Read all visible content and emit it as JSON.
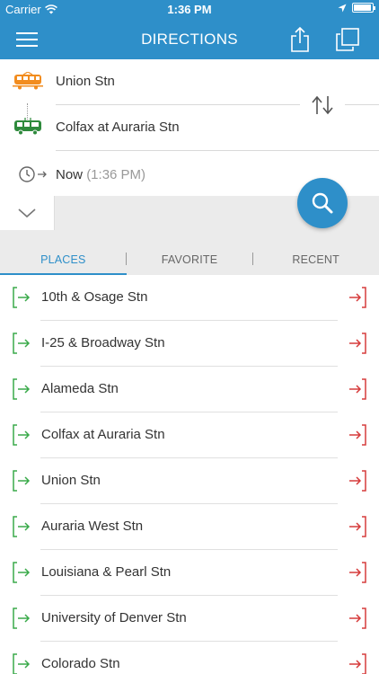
{
  "status_bar": {
    "carrier": "Carrier",
    "time": "1:36 PM"
  },
  "nav": {
    "title": "DIRECTIONS"
  },
  "route": {
    "from": "Union Stn",
    "to": "Colfax at Auraria Stn",
    "time_label": "Now",
    "time_detail": "(1:36 PM)"
  },
  "tabs": [
    {
      "label": "PLACES"
    },
    {
      "label": "FAVORITE"
    },
    {
      "label": "RECENT"
    }
  ],
  "places": [
    {
      "label": "10th & Osage Stn"
    },
    {
      "label": "I-25 & Broadway Stn"
    },
    {
      "label": "Alameda Stn"
    },
    {
      "label": "Colfax at Auraria Stn"
    },
    {
      "label": "Union Stn"
    },
    {
      "label": "Auraria West Stn"
    },
    {
      "label": "Louisiana & Pearl Stn"
    },
    {
      "label": "University of Denver Stn"
    },
    {
      "label": "Colorado Stn"
    }
  ],
  "colors": {
    "accent": "#2e8fc9",
    "train_orange": "#f28c1e",
    "bus_green": "#2e8a3c",
    "enter_green": "#3aaa4a",
    "exit_red": "#d63b3b"
  },
  "icons": {
    "menu": "hamburger-icon",
    "share": "share-icon",
    "copy": "copy-icon",
    "from": "train-icon",
    "to": "bus-icon",
    "swap": "swap-icon",
    "time": "clock-icon",
    "collapse": "chevron-down-icon",
    "search": "search-icon",
    "set_origin": "enter-icon",
    "set_destination": "exit-icon"
  }
}
